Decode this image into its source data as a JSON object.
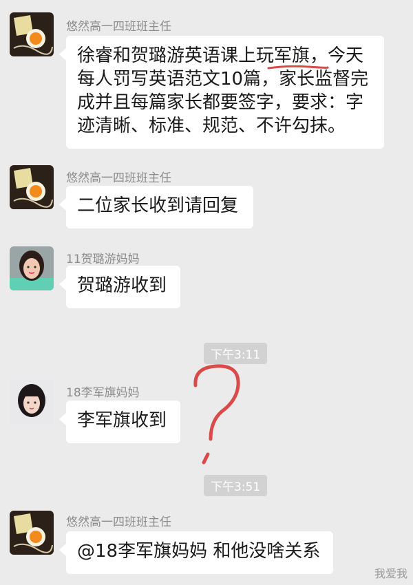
{
  "messages": [
    {
      "sender": "悠然高一四班班主任",
      "lines": [
        "徐睿和贺璐游英语课上玩军旗，今天",
        "每人罚写英语范文10篇，家长监督完",
        "成并且每篇家长都要签字，要求：字",
        "迹清晰、标准、规范、不许勾抹。"
      ]
    },
    {
      "sender": "悠然高一四班班主任",
      "lines": [
        "二位家长收到请回复"
      ]
    },
    {
      "sender": "11贺璐游妈妈",
      "lines": [
        "贺璐游收到"
      ]
    },
    {
      "sender": "18李军旗妈妈",
      "lines": [
        "李军旗收到"
      ]
    },
    {
      "sender": "悠然高一四班班主任",
      "lines": [
        "@18李军旗妈妈 和他没啥关系"
      ]
    }
  ],
  "timestamps": [
    "下午3:11",
    "下午3:51"
  ],
  "annotation": {
    "mark": "?",
    "color": "#d94a4a"
  },
  "watermark": "我爱我"
}
